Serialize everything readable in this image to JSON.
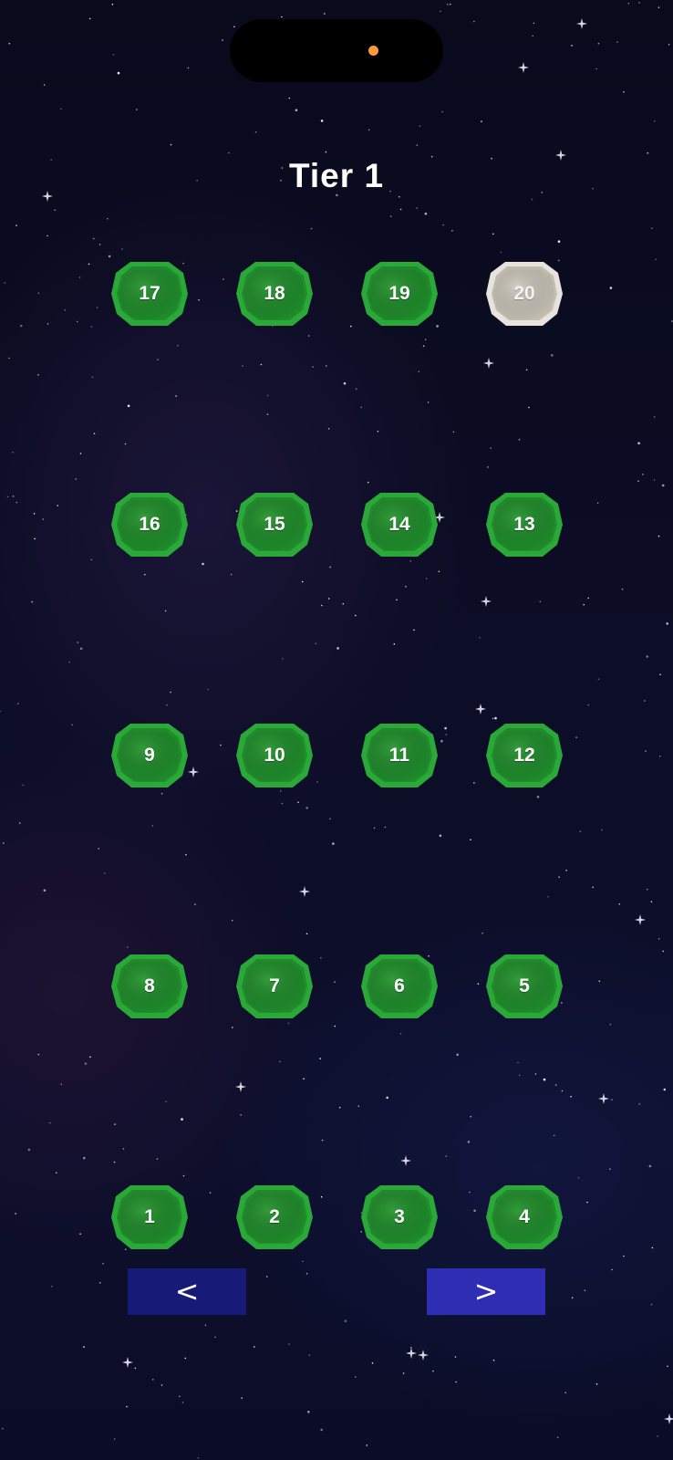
{
  "title": "Tier 1",
  "levels": [
    {
      "number": "17",
      "state": "unlocked"
    },
    {
      "number": "18",
      "state": "unlocked"
    },
    {
      "number": "19",
      "state": "unlocked"
    },
    {
      "number": "20",
      "state": "locked"
    },
    {
      "number": "16",
      "state": "unlocked"
    },
    {
      "number": "15",
      "state": "unlocked"
    },
    {
      "number": "14",
      "state": "unlocked"
    },
    {
      "number": "13",
      "state": "unlocked"
    },
    {
      "number": "9",
      "state": "unlocked"
    },
    {
      "number": "10",
      "state": "unlocked"
    },
    {
      "number": "11",
      "state": "unlocked"
    },
    {
      "number": "12",
      "state": "unlocked"
    },
    {
      "number": "8",
      "state": "unlocked"
    },
    {
      "number": "7",
      "state": "unlocked"
    },
    {
      "number": "6",
      "state": "unlocked"
    },
    {
      "number": "5",
      "state": "unlocked"
    },
    {
      "number": "1",
      "state": "unlocked"
    },
    {
      "number": "2",
      "state": "unlocked"
    },
    {
      "number": "3",
      "state": "unlocked"
    },
    {
      "number": "4",
      "state": "unlocked"
    }
  ],
  "nav": {
    "prev_label": "<",
    "next_label": ">"
  },
  "colors": {
    "background": "#0a0b1f",
    "level_unlocked": "#22922e",
    "level_locked": "#c9c4b8",
    "prev_button": "#181a78",
    "next_button": "#2e2db4",
    "camera_indicator": "#ff9a3c"
  }
}
